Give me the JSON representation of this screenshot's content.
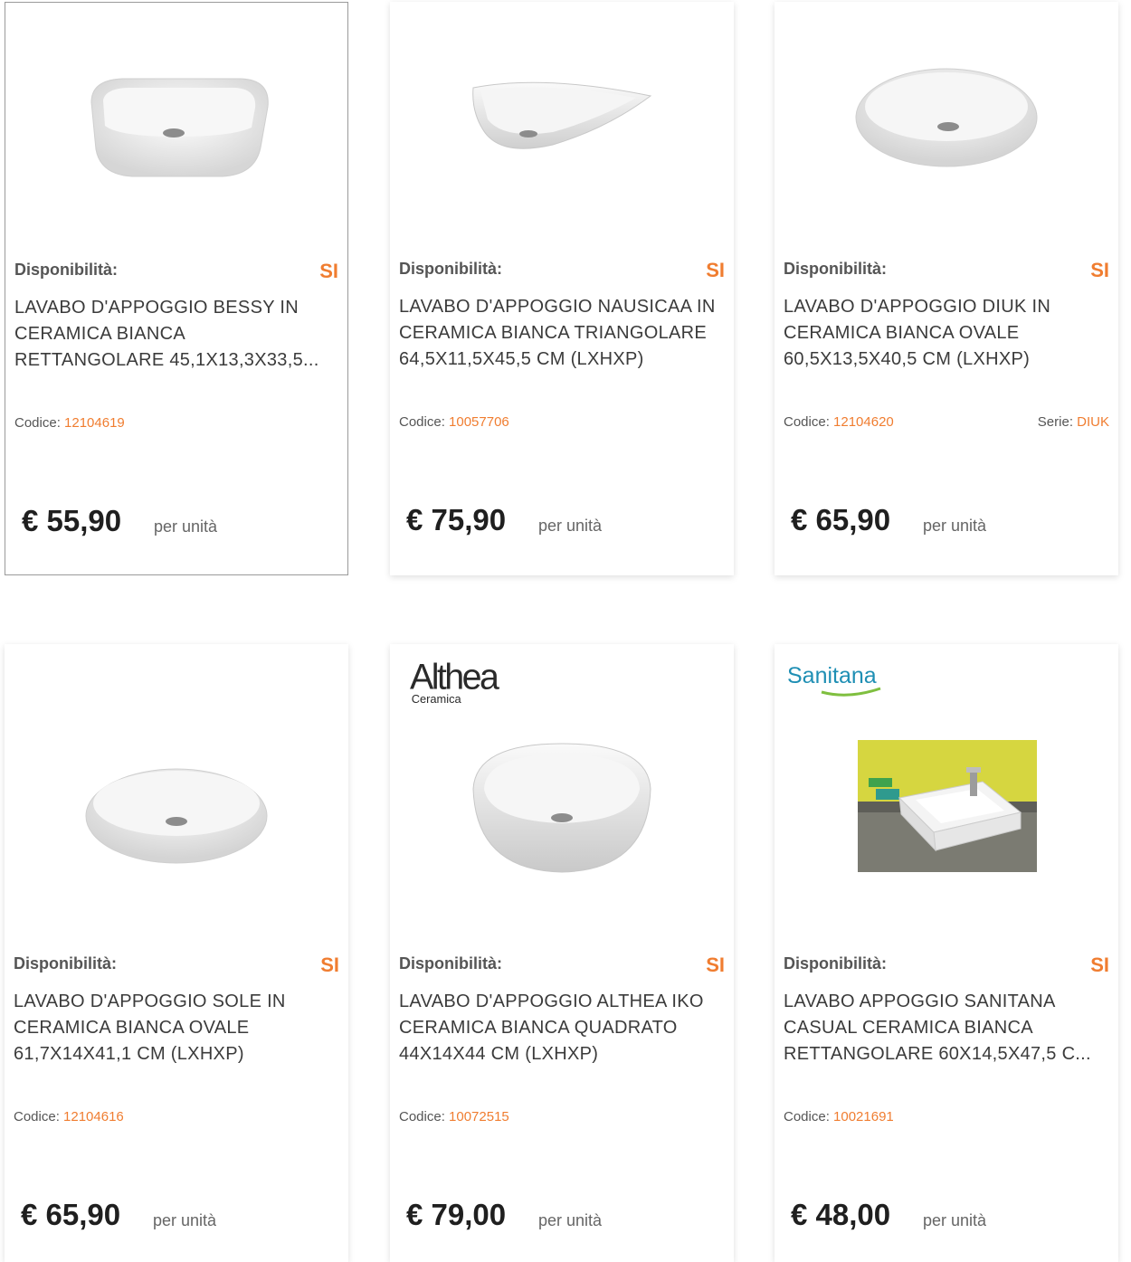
{
  "accent_color": "#f07d30",
  "products": [
    {
      "availability_label": "Disponibilità:",
      "availability_value": "SI",
      "title": "LAVABO D'APPOGGIO BESSY IN CERAMICA BIANCA RETTANGOLARE 45,1X13,3X33,5...",
      "code_label": "Codice:",
      "code_value": "12104619",
      "price": "€ 55,90",
      "unit": "per unità"
    },
    {
      "availability_label": "Disponibilità:",
      "availability_value": "SI",
      "title": "LAVABO D'APPOGGIO NAUSICAA IN CERAMICA BIANCA TRIANGOLARE 64,5X11,5X45,5 CM (LXHXP)",
      "code_label": "Codice:",
      "code_value": "10057706",
      "price": "€ 75,90",
      "unit": "per unità"
    },
    {
      "availability_label": "Disponibilità:",
      "availability_value": "SI",
      "title": "LAVABO D'APPOGGIO DIUK IN CERAMICA BIANCA OVALE 60,5X13,5X40,5 CM (LXHXP)",
      "code_label": "Codice:",
      "code_value": "12104620",
      "serie_label": "Serie:",
      "serie_value": "DIUK",
      "price": "€ 65,90",
      "unit": "per unità"
    },
    {
      "availability_label": "Disponibilità:",
      "availability_value": "SI",
      "title": "LAVABO D'APPOGGIO SOLE IN CERAMICA BIANCA OVALE 61,7X14X41,1 CM (LXHXP)",
      "code_label": "Codice:",
      "code_value": "12104616",
      "price": "€ 65,90",
      "unit": "per unità"
    },
    {
      "brand_name": "Althea",
      "brand_sub": "Ceramica",
      "availability_label": "Disponibilità:",
      "availability_value": "SI",
      "title": "LAVABO D'APPOGGIO ALTHEA IKO CERAMICA BIANCA QUADRATO 44X14X44 CM (LXHXP)",
      "code_label": "Codice:",
      "code_value": "10072515",
      "price": "€ 79,00",
      "unit": "per unità"
    },
    {
      "brand_name": "Sanitana",
      "availability_label": "Disponibilità:",
      "availability_value": "SI",
      "title": "LAVABO APPOGGIO SANITANA CASUAL CERAMICA BIANCA RETTANGOLARE 60X14,5X47,5 C...",
      "code_label": "Codice:",
      "code_value": "10021691",
      "price": "€ 48,00",
      "unit": "per unità"
    }
  ]
}
